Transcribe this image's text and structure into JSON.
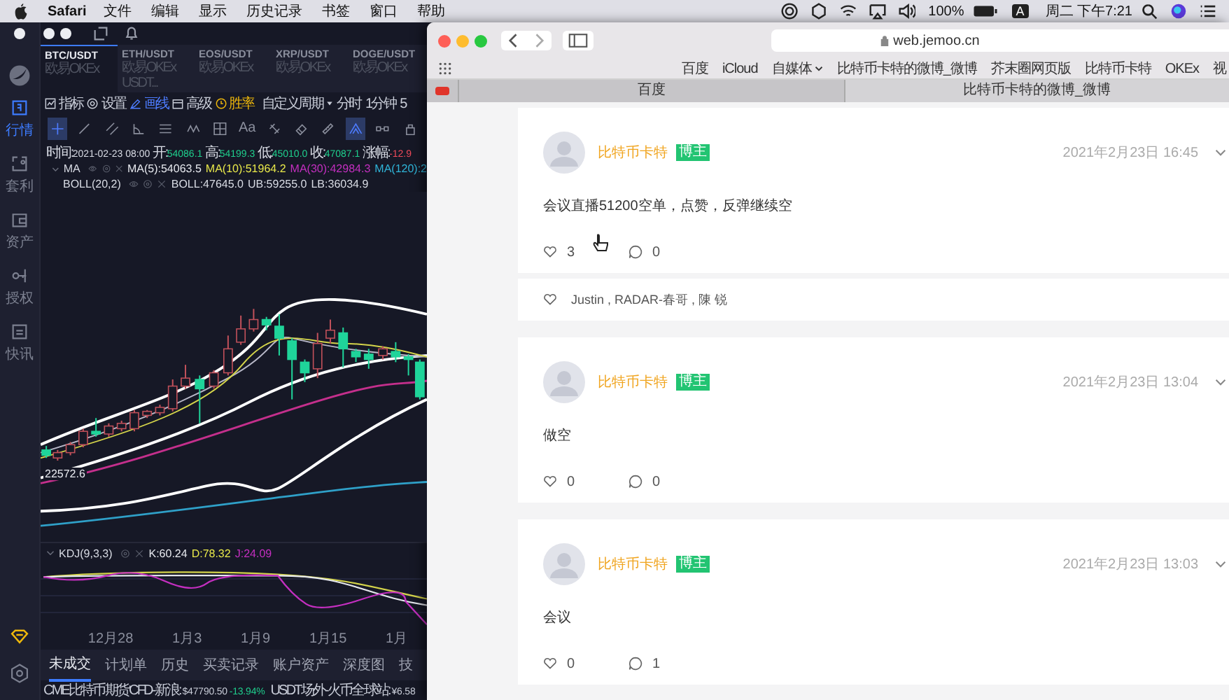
{
  "menu_bar": {
    "app": "Safari",
    "menus": [
      "文件",
      "编辑",
      "显示",
      "历史记录",
      "书签",
      "窗口",
      "帮助"
    ],
    "battery": "100%",
    "input_source": "A",
    "clock": "周二 下午7:21"
  },
  "trading_app": {
    "sidebar": [
      {
        "label": "行情",
        "kind": "market",
        "selected": true
      },
      {
        "label": "套利",
        "kind": "arbitrage",
        "selected": false
      },
      {
        "label": "资产",
        "kind": "wallet",
        "selected": false
      },
      {
        "label": "授权",
        "kind": "key",
        "selected": false
      },
      {
        "label": "快讯",
        "kind": "news",
        "selected": false
      }
    ],
    "pairs": [
      {
        "symbol": "BTC/USDT",
        "exchange": "欧易OKEx",
        "selected": true
      },
      {
        "symbol": "ETH/USDT",
        "exchange": "欧易OKEx USDT...",
        "selected": false
      },
      {
        "symbol": "EOS/USDT",
        "exchange": "欧易OKEx",
        "selected": false
      },
      {
        "symbol": "XRP/USDT",
        "exchange": "欧易OKEx",
        "selected": false
      },
      {
        "symbol": "DOGE/USDT",
        "exchange": "欧易OKEx",
        "selected": false
      }
    ],
    "toolbar": [
      {
        "label": "指标",
        "kind": "chart",
        "color": "#c9cdd8"
      },
      {
        "label": "设置",
        "kind": "gear",
        "color": "#c9cdd8"
      },
      {
        "label": "画线",
        "kind": "pen",
        "color": "#4d7cfe"
      },
      {
        "label": "高级",
        "kind": "panel",
        "color": "#c9cdd8"
      },
      {
        "label": "胜率",
        "kind": "clock",
        "color": "#f0b90b"
      }
    ],
    "periods": [
      {
        "label": "自定义周期",
        "dropdown": true
      },
      {
        "label": "分时",
        "dropdown": false
      },
      {
        "label": "1分钟",
        "dropdown": false
      },
      {
        "label": "5",
        "dropdown": false
      }
    ],
    "draw_tools": [
      {
        "kind": "crosshair",
        "selected": true
      },
      {
        "kind": "line",
        "selected": false
      },
      {
        "kind": "parallel",
        "selected": false
      },
      {
        "kind": "angle",
        "selected": false
      },
      {
        "kind": "lines",
        "selected": false
      },
      {
        "kind": "wave",
        "selected": false
      },
      {
        "kind": "grid",
        "selected": false
      },
      {
        "kind": "text",
        "label": "Aa",
        "selected": false
      },
      {
        "kind": "magnet",
        "selected": false
      },
      {
        "kind": "eraser",
        "selected": false
      },
      {
        "kind": "ruler",
        "selected": false
      },
      {
        "kind": "pattern",
        "selected": true
      },
      {
        "kind": "chain",
        "selected": false
      },
      {
        "kind": "lock",
        "selected": false
      }
    ],
    "ohlc": [
      {
        "label": "时间:",
        "value": "2021-02-23 08:00",
        "color": "#d8dbe4"
      },
      {
        "label": "开:",
        "value": "54086.1",
        "color": "#1fcf8d"
      },
      {
        "label": "高:",
        "value": "54199.3",
        "color": "#1fcf8d"
      },
      {
        "label": "低:",
        "value": "45010.0",
        "color": "#1fcf8d"
      },
      {
        "label": "收:",
        "value": "47087.1",
        "color": "#1fcf8d"
      },
      {
        "label": "涨幅:",
        "value": "-12.9",
        "color": "#f04a5a"
      }
    ],
    "ma": {
      "name": "MA",
      "values": [
        {
          "text": "MA(5):54063.5",
          "color": "#e6e8ee"
        },
        {
          "text": "MA(10):51964.2",
          "color": "#e8e84a"
        },
        {
          "text": "MA(30):42984.3",
          "color": "#c42fc0"
        },
        {
          "text": "MA(120):2",
          "color": "#2fb4d8"
        }
      ]
    },
    "boll": {
      "name": "BOLL(20,2)",
      "values": [
        "BOLL:47645.0",
        "UB:59255.0",
        "LB:36034.9"
      ]
    },
    "price_label": "22572.6",
    "kdj": {
      "name": "KDJ(9,3,3)",
      "values": [
        {
          "text": "K:60.24",
          "color": "#e6e8ee"
        },
        {
          "text": "D:78.32",
          "color": "#e8e84a"
        },
        {
          "text": "J:24.09",
          "color": "#c42fc0"
        }
      ]
    },
    "x_axis": [
      "12月28",
      "1月3",
      "1月9",
      "1月15",
      "1月"
    ],
    "bottom_tabs": [
      {
        "label": "未成交",
        "selected": true
      },
      {
        "label": "计划单",
        "selected": false
      },
      {
        "label": "历史",
        "selected": false
      },
      {
        "label": "买卖记录",
        "selected": false
      },
      {
        "label": "账户资产",
        "selected": false
      },
      {
        "label": "深度图",
        "selected": false
      },
      {
        "label": "技",
        "selected": false
      }
    ],
    "ticker": [
      {
        "source": "CME比特币期货CFD-新浪:",
        "price": "$47790.50",
        "change": "-13.94%"
      },
      {
        "source": "USDT场外-火币全球站:",
        "price": "¥6.58"
      }
    ]
  },
  "browser": {
    "url": "web.jemoo.cn",
    "bookmarks": [
      {
        "label": "百度",
        "dropdown": false
      },
      {
        "label": "iCloud",
        "dropdown": false
      },
      {
        "label": "自媒体",
        "dropdown": true
      },
      {
        "label": "比特币卡特的微博_微博",
        "dropdown": false
      },
      {
        "label": "芥末圈网页版",
        "dropdown": false
      },
      {
        "label": "比特币卡特",
        "dropdown": false
      },
      {
        "label": "OKEx",
        "dropdown": false
      },
      {
        "label": "视",
        "dropdown": false
      }
    ],
    "tabs": [
      {
        "title": "百度",
        "selected": false
      },
      {
        "title": "比特币卡特的微博_微博",
        "selected": true
      }
    ]
  },
  "posts": [
    {
      "author": "比特币卡特",
      "badge": "博主",
      "date": "2021年2月23日 16:45",
      "text": "会议直播51200空单，点赞，反弹继续空",
      "likes": "3",
      "comments": "0",
      "liked_by": "Justin , RADAR-春哥 , 陳 锐"
    },
    {
      "author": "比特币卡特",
      "badge": "博主",
      "date": "2021年2月23日 13:04",
      "text": "做空",
      "likes": "0",
      "comments": "0"
    },
    {
      "author": "比特币卡特",
      "badge": "博主",
      "date": "2021年2月23日 13:03",
      "text": "会议",
      "likes": "0",
      "comments": "1"
    }
  ]
}
